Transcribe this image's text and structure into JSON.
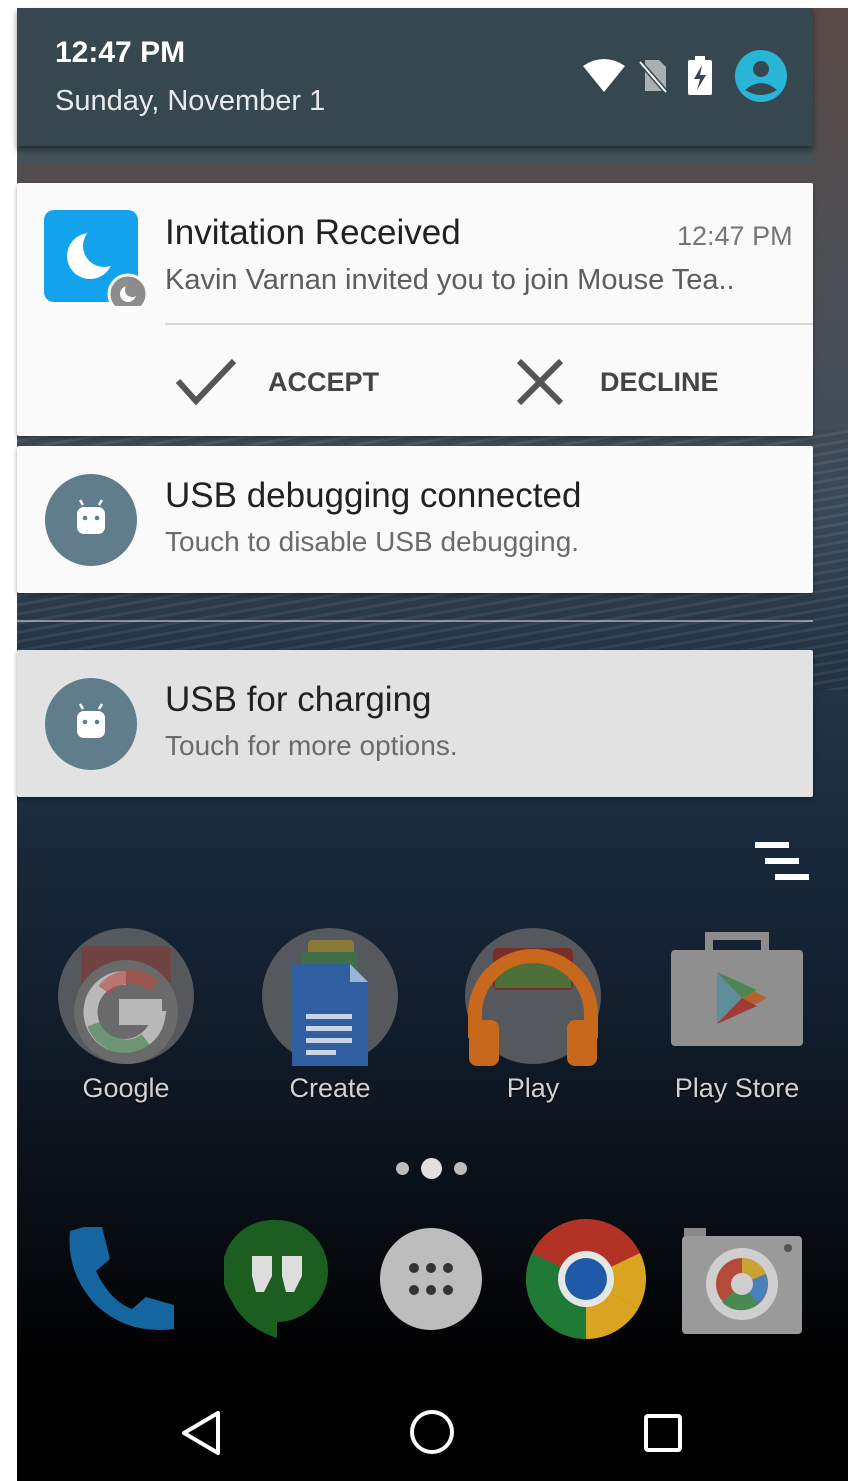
{
  "status_bar": {
    "time": "12:47 PM",
    "date": "Sunday, November 1",
    "icons": [
      "wifi-icon",
      "no-sim-icon",
      "battery-charging-icon",
      "user-account-icon"
    ],
    "accent": "#29b6d6"
  },
  "notifications": [
    {
      "app_icon": "moon-icon",
      "title": "Invitation Received",
      "time": "12:47 PM",
      "text": "Kavin Varnan invited you to join Mouse Tea..",
      "actions": [
        {
          "icon": "check-icon",
          "label": "ACCEPT"
        },
        {
          "icon": "close-icon",
          "label": "DECLINE"
        }
      ]
    },
    {
      "app_icon": "android-icon",
      "title": "USB debugging connected",
      "text": "Touch to disable USB debugging."
    },
    {
      "app_icon": "android-icon",
      "title": "USB for charging",
      "text": "Touch for more options."
    }
  ],
  "home": {
    "apps": [
      {
        "icon": "google-folder-icon",
        "label": "Google"
      },
      {
        "icon": "create-folder-icon",
        "label": "Create"
      },
      {
        "icon": "play-folder-icon",
        "label": "Play"
      },
      {
        "icon": "play-store-icon",
        "label": "Play Store"
      }
    ],
    "dock": [
      "phone-icon",
      "hangouts-icon",
      "app-drawer-icon",
      "chrome-icon",
      "camera-icon"
    ]
  },
  "nav_bar": [
    "back-icon",
    "home-icon",
    "recents-icon"
  ]
}
